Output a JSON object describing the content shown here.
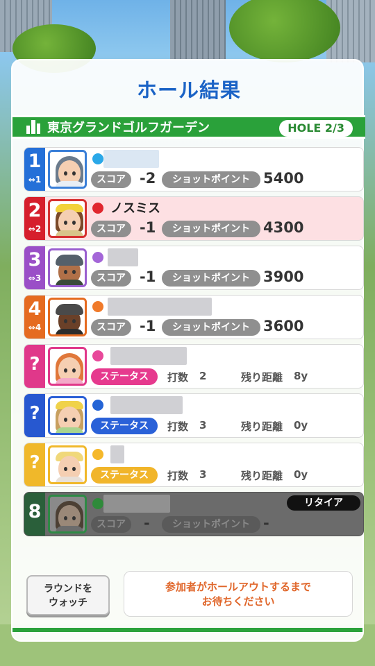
{
  "title": "ホール結果",
  "course": {
    "name": "東京グランドゴルフガーデン",
    "hole": "HOLE 2/3"
  },
  "labels": {
    "score": "スコア",
    "shot_points": "ショットポイント",
    "status": "ステータス",
    "strokes": "打数",
    "remaining": "残り距離"
  },
  "players": [
    {
      "rank": "1",
      "rank_sub": "⇔1",
      "rank_color": "#2470d8",
      "dot_color": "#2aa8e8",
      "name": "",
      "score": "-2",
      "points": "5400",
      "avatar": {
        "border": "#3a7fd8",
        "hair": "#6b7b8c",
        "body": "#e8eef5"
      }
    },
    {
      "rank": "2",
      "rank_sub": "⇔2",
      "rank_color": "#d61f2c",
      "dot_color": "#e0262e",
      "name": "ノスミス",
      "score": "-1",
      "points": "4300",
      "avatar": {
        "border": "#d63030",
        "hair": "#f2d23a",
        "body": "#d8c48a"
      }
    },
    {
      "rank": "3",
      "rank_sub": "⇔3",
      "rank_color": "#9a4fc7",
      "dot_color": "#a466d8",
      "name": "",
      "score": "-1",
      "points": "3900",
      "avatar": {
        "border": "#9a5fcf",
        "hair": "#55606a",
        "body": "#3a4a3a"
      }
    },
    {
      "rank": "4",
      "rank_sub": "⇔4",
      "rank_color": "#e56b20",
      "dot_color": "#f07a2a",
      "name": "",
      "score": "-1",
      "points": "3600",
      "avatar": {
        "border": "#e56b20",
        "hair": "#4a4a4a",
        "body": "#2c2c2c"
      }
    },
    {
      "rank": "?",
      "rank_color": "#e0388a",
      "dot_color": "#e8489a",
      "name": "",
      "strokes": "2",
      "remaining": "8y",
      "avatar": {
        "border": "#e0388a",
        "hair": "#e0773a",
        "body": "#f3a9c8"
      }
    },
    {
      "rank": "?",
      "rank_color": "#2758d0",
      "dot_color": "#2464d6",
      "name": "",
      "strokes": "3",
      "remaining": "0y",
      "avatar": {
        "border": "#2a5fd6",
        "hair": "#f0d24a",
        "body": "#a9d48f"
      }
    },
    {
      "rank": "?",
      "rank_color": "#f0b82a",
      "dot_color": "#f5b82a",
      "name": "",
      "strokes": "3",
      "remaining": "0y",
      "avatar": {
        "border": "#f0b82a",
        "hair": "#f0d87a",
        "body": "#e8e0d8"
      }
    },
    {
      "rank": "8",
      "rank_color": "#2a5f3a",
      "dot_color": "#2f8a3a",
      "name": "",
      "score": "-",
      "points": "-",
      "retired": "リタイア",
      "avatar": {
        "border": "#2e8a45",
        "hair": "#4c4034",
        "body": "#6c6c6c"
      }
    }
  ],
  "buttons": {
    "watch_round": "ラウンドを\nウォッチ"
  },
  "waiting_message": "参加者がホールアウトするまで\nお待ちください",
  "colors": {
    "title": "#1b63c6",
    "course_bar": "#2aa13a",
    "status_pink": "#e63a8e",
    "status_blue": "#2a61d8",
    "status_yellow": "#f1b52a",
    "wait_text": "#e0662a"
  }
}
